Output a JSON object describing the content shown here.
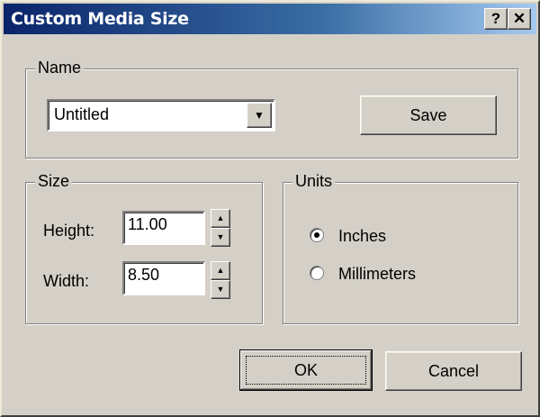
{
  "window": {
    "title": "Custom Media Size",
    "help_label": "?",
    "close_label": "✕"
  },
  "name_group": {
    "legend": "Name",
    "combo_value": "Untitled",
    "combo_arrow": "▼",
    "save_label": "Save"
  },
  "size_group": {
    "legend": "Size",
    "height_label": "Height:",
    "height_value": "11.00",
    "width_label": "Width:",
    "width_value": "8.50",
    "up_arrow": "▲",
    "down_arrow": "▼"
  },
  "units_group": {
    "legend": "Units",
    "options": [
      {
        "label": "Inches",
        "selected": true
      },
      {
        "label": "Millimeters",
        "selected": false
      }
    ]
  },
  "buttons": {
    "ok_label": "OK",
    "cancel_label": "Cancel"
  }
}
